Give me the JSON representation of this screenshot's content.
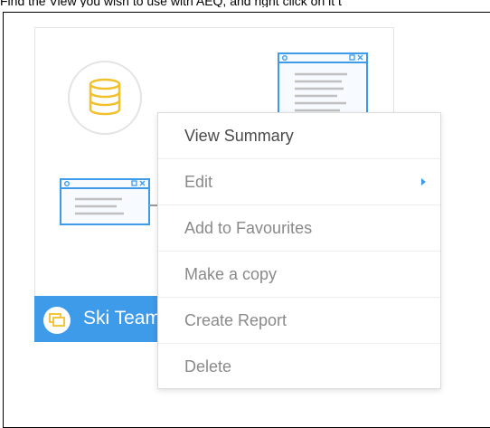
{
  "instruction": "Find the View you wish to use with AEQ, and right click on it t",
  "card": {
    "title": "Ski Team",
    "accent_color": "#3d9be9",
    "database_color": "#f2c02b",
    "icons": [
      "database-icon",
      "view-window-icon",
      "view-window-icon",
      "view-avatar-icon"
    ]
  },
  "context_menu": {
    "items": [
      {
        "label": "View Summary"
      },
      {
        "label": "Edit",
        "has_submenu": true
      },
      {
        "label": "Add to Favourites"
      },
      {
        "label": "Make a copy"
      },
      {
        "label": "Create Report"
      },
      {
        "label": "Delete"
      }
    ],
    "submenu_arrow_color": "#3d9be9"
  }
}
